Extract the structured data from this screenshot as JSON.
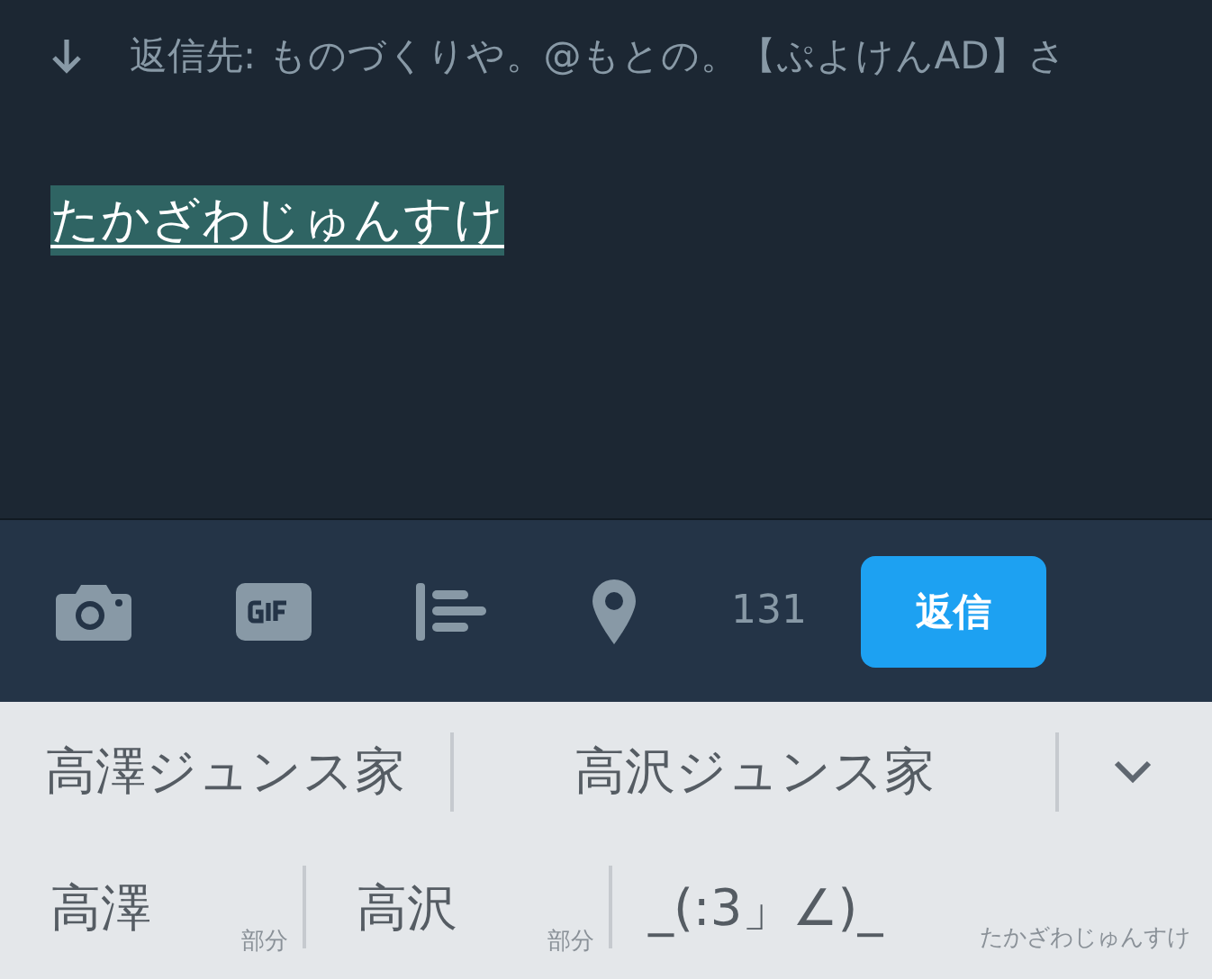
{
  "reply_to": {
    "label": "返信先: ものづくりや。@もとの。【ぷよけんAD】さ"
  },
  "composer": {
    "text": "たかざわじゅんすけ",
    "highlighted": true
  },
  "toolbar": {
    "counter": "131",
    "submit": "返信"
  },
  "candidates": {
    "row_1": [
      {
        "text": "高澤ジュンス家"
      },
      {
        "text": "高沢ジュンス家"
      }
    ],
    "row_2": [
      {
        "text": "高澤",
        "note": "部分"
      },
      {
        "text": "高沢",
        "note": "部分"
      },
      {
        "text": "_(:3」∠)_"
      }
    ],
    "reading": "たかざわじゅんすけ"
  }
}
